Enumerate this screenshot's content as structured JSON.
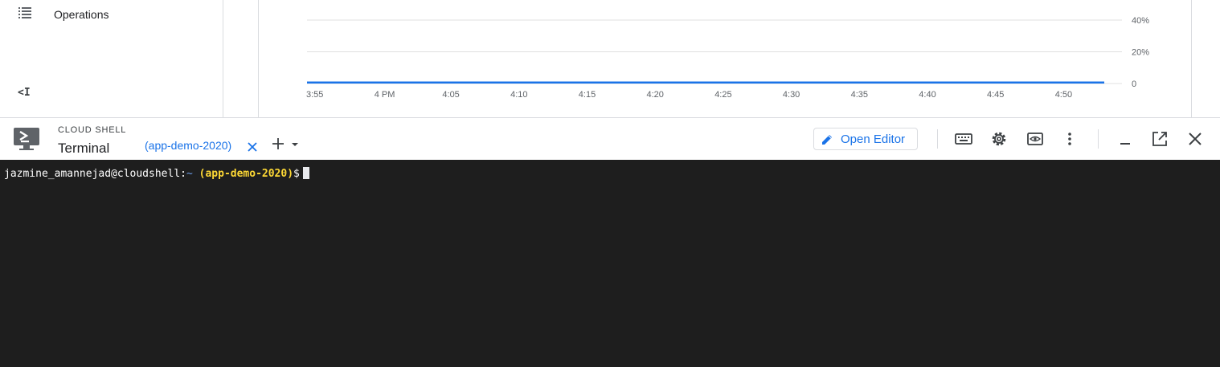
{
  "sidebar": {
    "operations_label": "Operations",
    "collapse_glyph": "<I"
  },
  "chart_data": {
    "type": "line",
    "x": [
      "3:55",
      "4 PM",
      "4:05",
      "4:10",
      "4:15",
      "4:20",
      "4:25",
      "4:30",
      "4:35",
      "4:40",
      "4:45",
      "4:50"
    ],
    "y_ticks": [
      "40%",
      "20%",
      "0"
    ],
    "ylim": [
      0,
      40
    ],
    "series": [
      {
        "values": [
          0.6,
          0.6,
          0.6,
          0.6,
          0.6,
          0.6,
          0.6,
          0.6,
          0.6,
          0.6,
          0.6,
          0.6,
          0.6
        ],
        "color": "#1a73e8"
      }
    ],
    "grid": true
  },
  "cloud_shell": {
    "small_title": "CLOUD SHELL",
    "title": "Terminal",
    "tab_label": "(app-demo-2020)",
    "open_editor_label": "Open Editor"
  },
  "terminal": {
    "prompt_user": "jazmine_amannejad@cloudshell:",
    "prompt_path": "~",
    "prompt_project": "(app-demo-2020)",
    "prompt_symbol": "$"
  },
  "icons": {
    "keyboard": "keyboard-icon",
    "settings": "gear-icon",
    "preview": "web-preview-icon",
    "more": "more-vert-icon",
    "minimize": "minimize-icon",
    "open_new": "open-in-new-icon",
    "close": "close-icon"
  }
}
